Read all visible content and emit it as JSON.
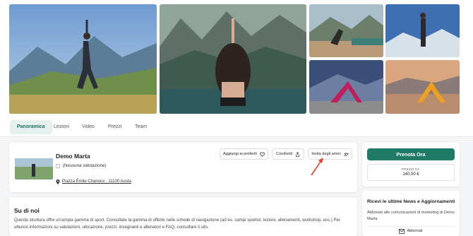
{
  "tabs": [
    {
      "label": "Panoramica"
    },
    {
      "label": "Lezioni"
    },
    {
      "label": "Video"
    },
    {
      "label": "Prezzi"
    },
    {
      "label": "Team"
    }
  ],
  "listing": {
    "name": "Demo Marta",
    "rating_text": "(Nessuna valutazione)",
    "address": "Piazza Émile Chanoux , 11100 Aosta"
  },
  "actions": {
    "favorite_label": "Aggiungi ai preferiti",
    "share_label": "Condividi",
    "invite_label": "Invita degli amici"
  },
  "about": {
    "title": "Su di noi",
    "text": "Questa struttura offre un'ampia gamma di sport. Consultate la gamma di offerte nelle schede di navigazione (ad es. campi sportivi, lezioni, allenamenti, workshop, ecc.) Per ulteriori informazioni su valutazioni, ubicazione, prezzi, insegnanti e allenatori e FAQ, consultare il sito."
  },
  "booking": {
    "button_label": "Prenota Ora",
    "price_label": "PREZZI DA",
    "price_value": "140,00 €"
  },
  "newsletter": {
    "title": "Ricevi le ultime News e Aggiornamenti",
    "text": "Abbonati alle comunicazioni di marketing di Demo Marta",
    "button_label": "Abbonati"
  },
  "colors": {
    "accent": "#1f7a67",
    "tab_active_bg": "#e4f1ee",
    "annotation_arrow": "#e8402a"
  },
  "icons": [
    "heart-icon",
    "share-icon",
    "invite-icon",
    "map-pin-icon",
    "mail-icon",
    "rating-icon"
  ]
}
